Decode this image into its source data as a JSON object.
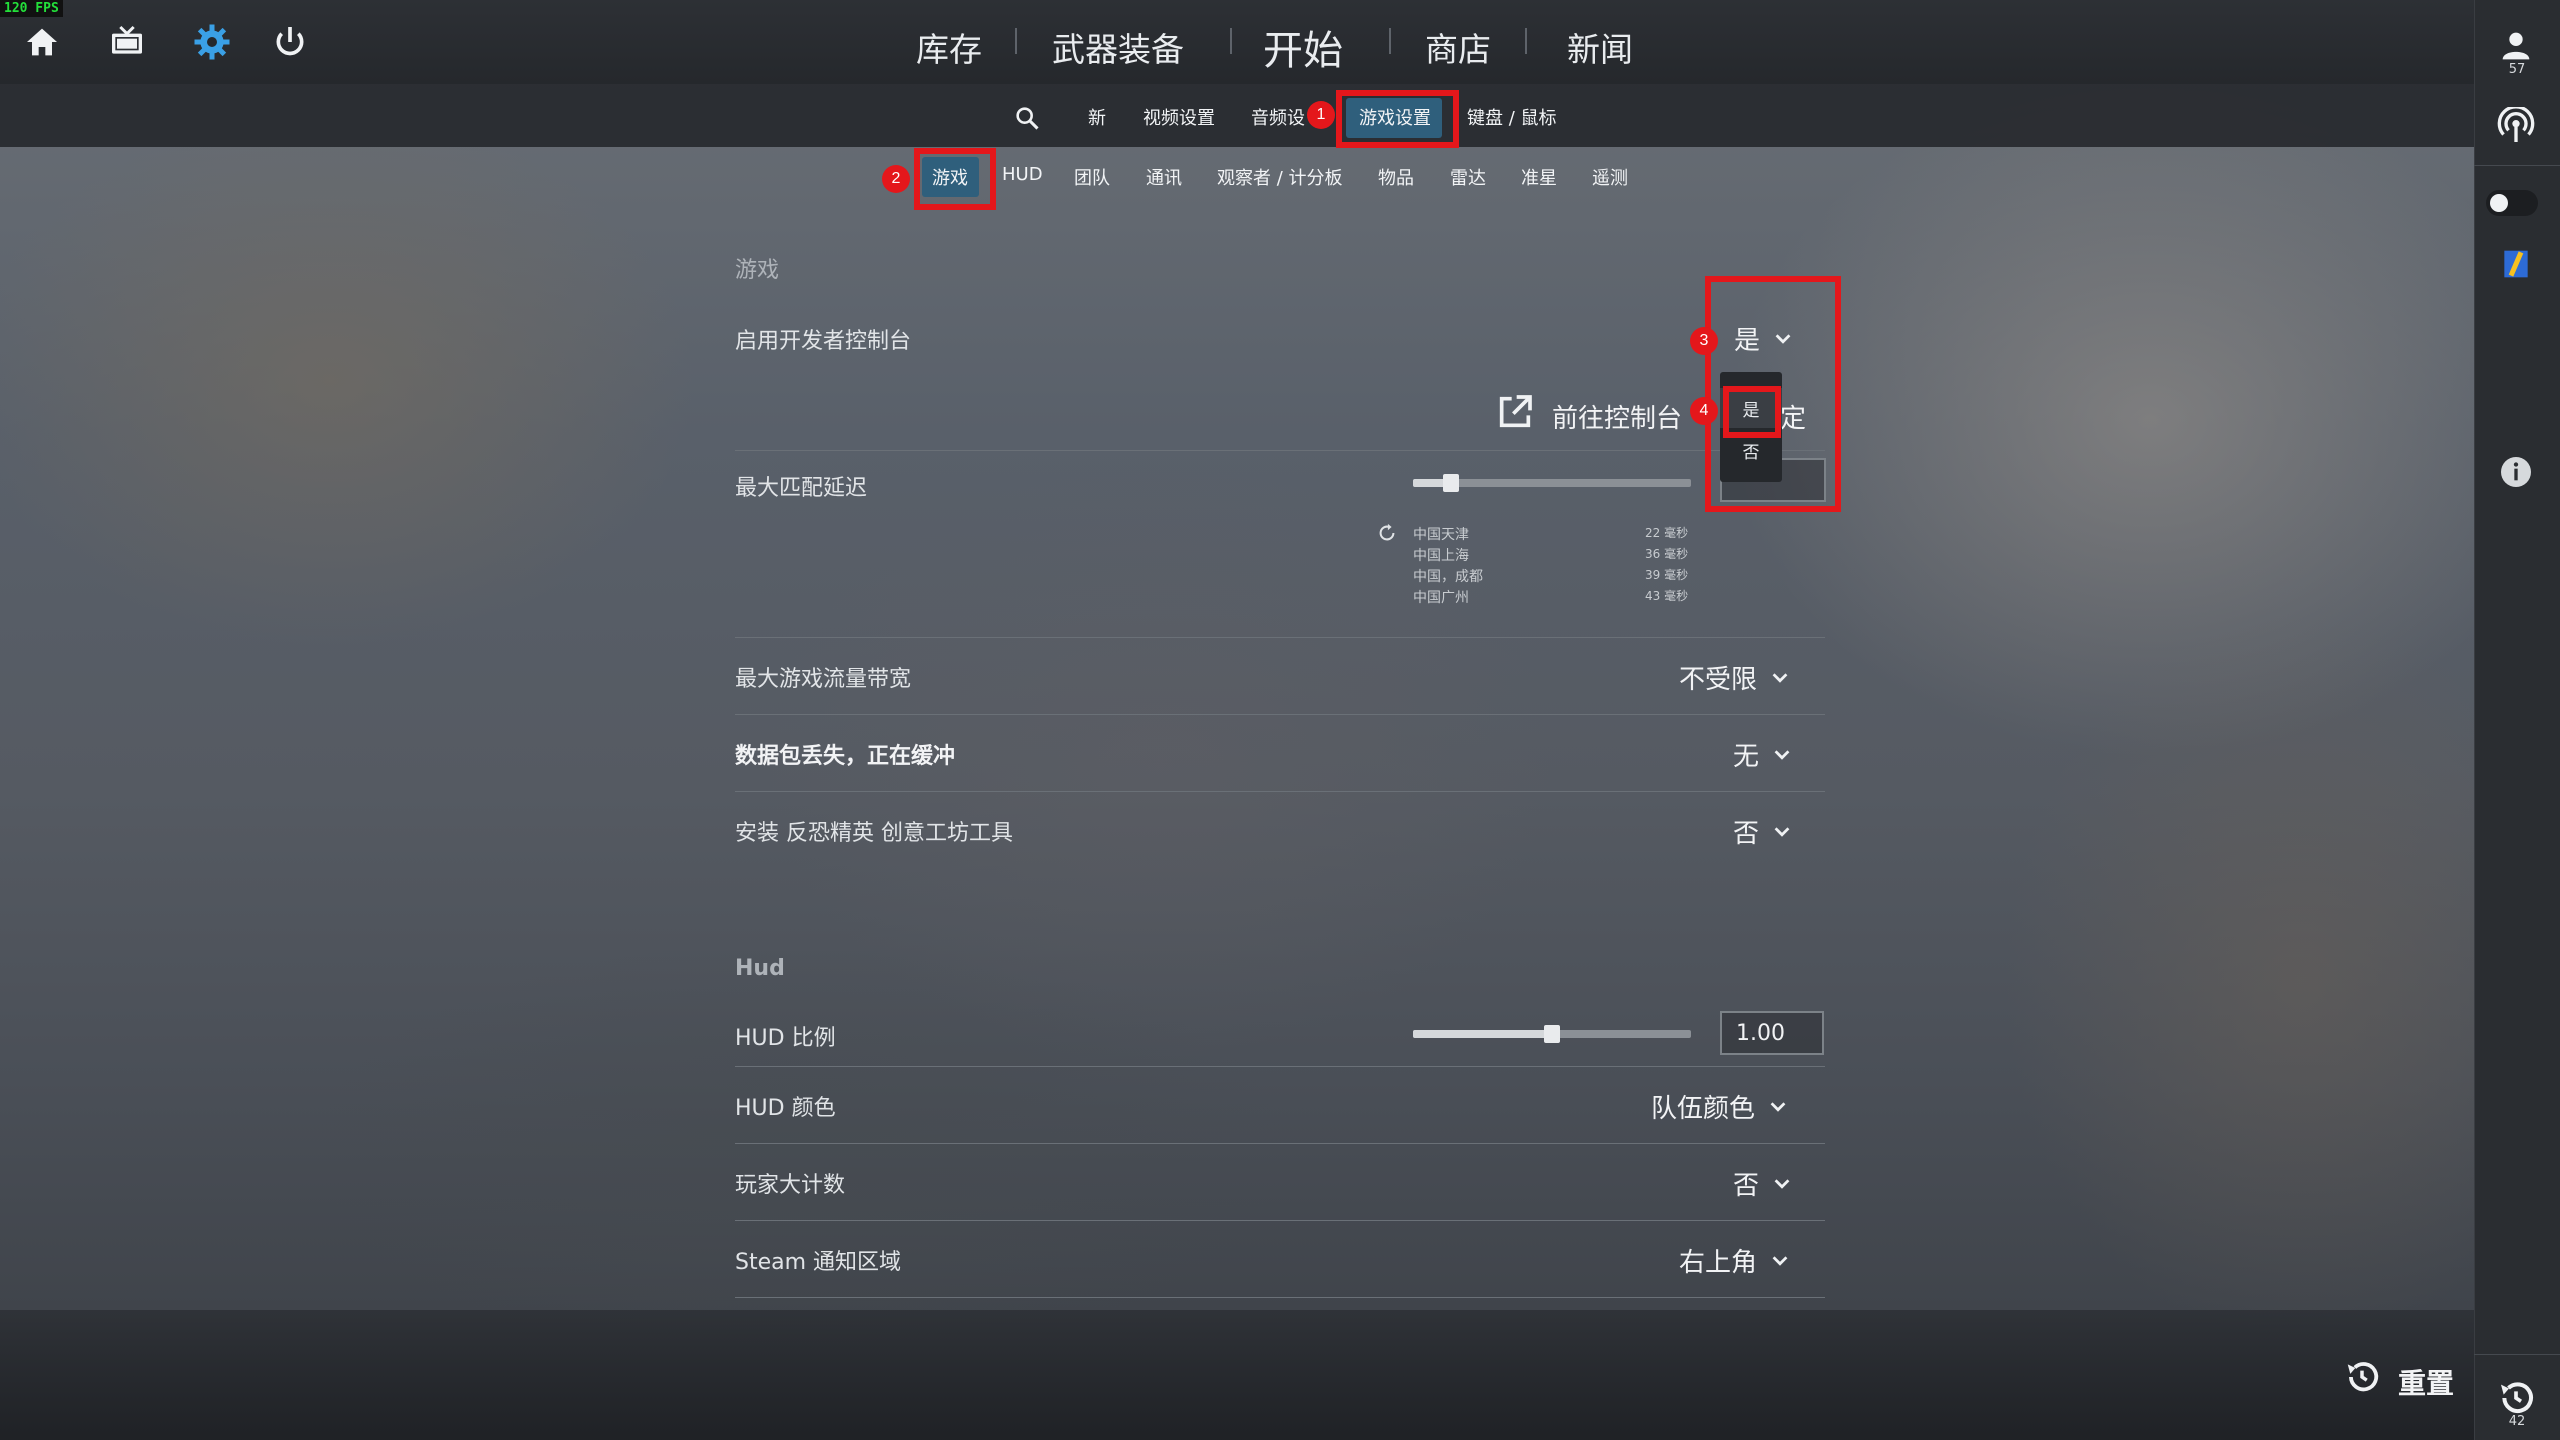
{
  "fps": "120 FPS",
  "main_nav": [
    {
      "label": "库存"
    },
    {
      "label": "武器装备"
    },
    {
      "label": "开始"
    },
    {
      "label": "商店"
    },
    {
      "label": "新闻"
    }
  ],
  "settings_nav": {
    "tabs": [
      {
        "label": "新"
      },
      {
        "label": "视频设置"
      },
      {
        "label": "音频设"
      },
      {
        "label": "游戏设置"
      },
      {
        "label": "键盘 / 鼠标"
      }
    ]
  },
  "game_subnav": {
    "tabs": [
      {
        "label": "游戏"
      },
      {
        "label": "HUD"
      },
      {
        "label": "团队"
      },
      {
        "label": "通讯"
      },
      {
        "label": "观察者 / 计分板"
      },
      {
        "label": "物品"
      },
      {
        "label": "雷达"
      },
      {
        "label": "准星"
      },
      {
        "label": "遥测"
      }
    ]
  },
  "sections": {
    "game": {
      "title": "游戏",
      "dev_console": {
        "label": "启用开发者控制台",
        "value": "是"
      },
      "goto_console_binding": {
        "label_left": "前往控制台",
        "label_right": "定"
      },
      "max_match_delay": {
        "label": "最大匹配延迟",
        "slider_fraction": 0.12
      },
      "ping_list": [
        {
          "name": "中国天津",
          "ms": "22 毫秒"
        },
        {
          "name": "中国上海",
          "ms": "36 毫秒"
        },
        {
          "name": "中国，成都",
          "ms": "39 毫秒"
        },
        {
          "name": "中国广州",
          "ms": "43 毫秒"
        }
      ],
      "max_bandwidth": {
        "label": "最大游戏流量带宽",
        "value": "不受限"
      },
      "packet_loss": {
        "label": "数据包丢失，正在缓冲",
        "value": "无"
      },
      "workshop_tools": {
        "label": "安装 反恐精英 创意工坊工具",
        "value": "否"
      }
    },
    "hud": {
      "title": "Hud",
      "hud_scale": {
        "label": "HUD 比例",
        "value": "1.00",
        "slider_fraction": 0.5
      },
      "hud_color": {
        "label": "HUD 颜色",
        "value": "队伍颜色"
      },
      "player_count": {
        "label": "玩家大计数",
        "value": "否"
      },
      "steam_notify": {
        "label": "Steam 通知区域",
        "value": "右上角"
      }
    }
  },
  "dropdown_menu": {
    "options": [
      "是",
      "否"
    ],
    "selected": "是"
  },
  "annotations": [
    "1",
    "2",
    "3",
    "4"
  ],
  "footer": {
    "reset_label": "重置"
  },
  "right_rail": {
    "friends_count": "57",
    "history_count": "42"
  },
  "colors": {
    "accent_tab": "#2f5f7c",
    "annotation_red": "#e4171b",
    "fps_green": "#23e03a"
  },
  "icons": [
    "home-icon",
    "tv-icon",
    "gear-icon",
    "power-icon",
    "search-icon",
    "refresh-icon",
    "external-link-icon",
    "chevron-down-icon",
    "history-icon",
    "user-icon",
    "broadcast-icon",
    "toggle-icon",
    "card-icon",
    "info-icon"
  ]
}
